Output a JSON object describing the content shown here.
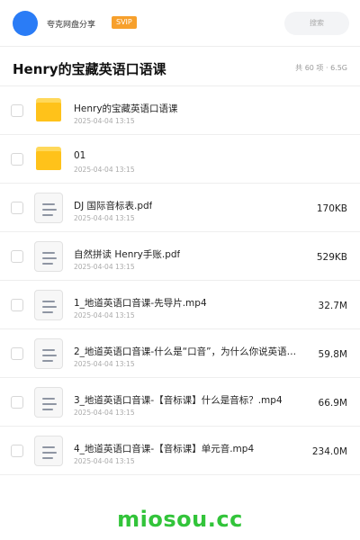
{
  "header": {
    "brand": "夸克网盘分享",
    "badge": "SVIP",
    "search_label": "搜索"
  },
  "page": {
    "title": "Henry的宝藏英语口语课",
    "summary": "共 60 项 · 6.5G"
  },
  "files": [
    {
      "type": "folder",
      "icon": "folder-icon",
      "name": "Henry的宝藏英语口语课",
      "date": "2025-04-04 13:15",
      "size": ""
    },
    {
      "type": "folder",
      "icon": "folder-icon",
      "name": "01",
      "date": "2025-04-04 13:15",
      "size": ""
    },
    {
      "type": "file",
      "icon": "document-icon",
      "name": "DJ 国际音标表.pdf",
      "date": "2025-04-04 13:15",
      "size": "170KB"
    },
    {
      "type": "file",
      "icon": "document-icon",
      "name": "自然拼读 Henry手账.pdf",
      "date": "2025-04-04 13:15",
      "size": "529KB"
    },
    {
      "type": "file",
      "icon": "document-icon",
      "name": "1_地道英语口音课-先导片.mp4",
      "date": "2025-04-04 13:15",
      "size": "32.7M"
    },
    {
      "type": "file",
      "icon": "document-icon",
      "name": "2_地道英语口音课-什么是“口音”，为什么你说英语…",
      "date": "2025-04-04 13:15",
      "size": "59.8M"
    },
    {
      "type": "file",
      "icon": "document-icon",
      "name": "3_地道英语口音课-【音标课】什么是音标？.mp4",
      "date": "2025-04-04 13:15",
      "size": "66.9M"
    },
    {
      "type": "file",
      "icon": "document-icon",
      "name": "4_地道英语口音课-【音标课】单元音.mp4",
      "date": "2025-04-04 13:15",
      "size": "234.0M"
    }
  ],
  "watermark": "miosou.cc",
  "colors": {
    "avatar": "#2a7cf6",
    "badge": "#f7a02c",
    "folder": "#ffc21a",
    "watermark": "#32c43a"
  }
}
